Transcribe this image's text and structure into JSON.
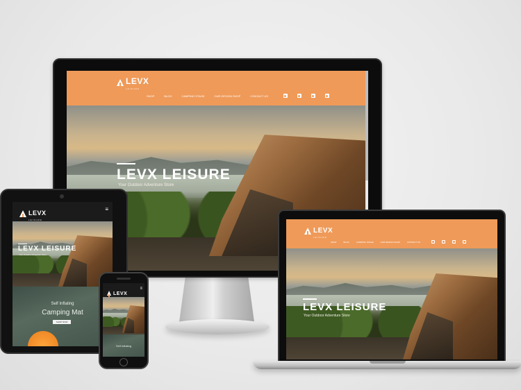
{
  "site": {
    "logo_text": "LEVX",
    "logo_sub": "LEISURE",
    "nav": [
      "SHOP",
      "BLOG",
      "CAMPING STAGE",
      "OUR DESIGN SHOP",
      "CONTACT US"
    ],
    "social_icons": [
      "facebook-icon",
      "instagram-icon",
      "twitter-icon",
      "youtube-icon"
    ],
    "hero_title": "LEVX LEISURE",
    "hero_tagline": "Your Outdoor Adventure Store",
    "mat_kicker": "Self Inflating",
    "mat_title": "Camping Mat",
    "mat_button": "SHOP NOW",
    "phone_section": "Self Inflating",
    "menu_glyph": "≡"
  },
  "colors": {
    "brand_orange": "#ef9a59",
    "background": "#ececec"
  }
}
